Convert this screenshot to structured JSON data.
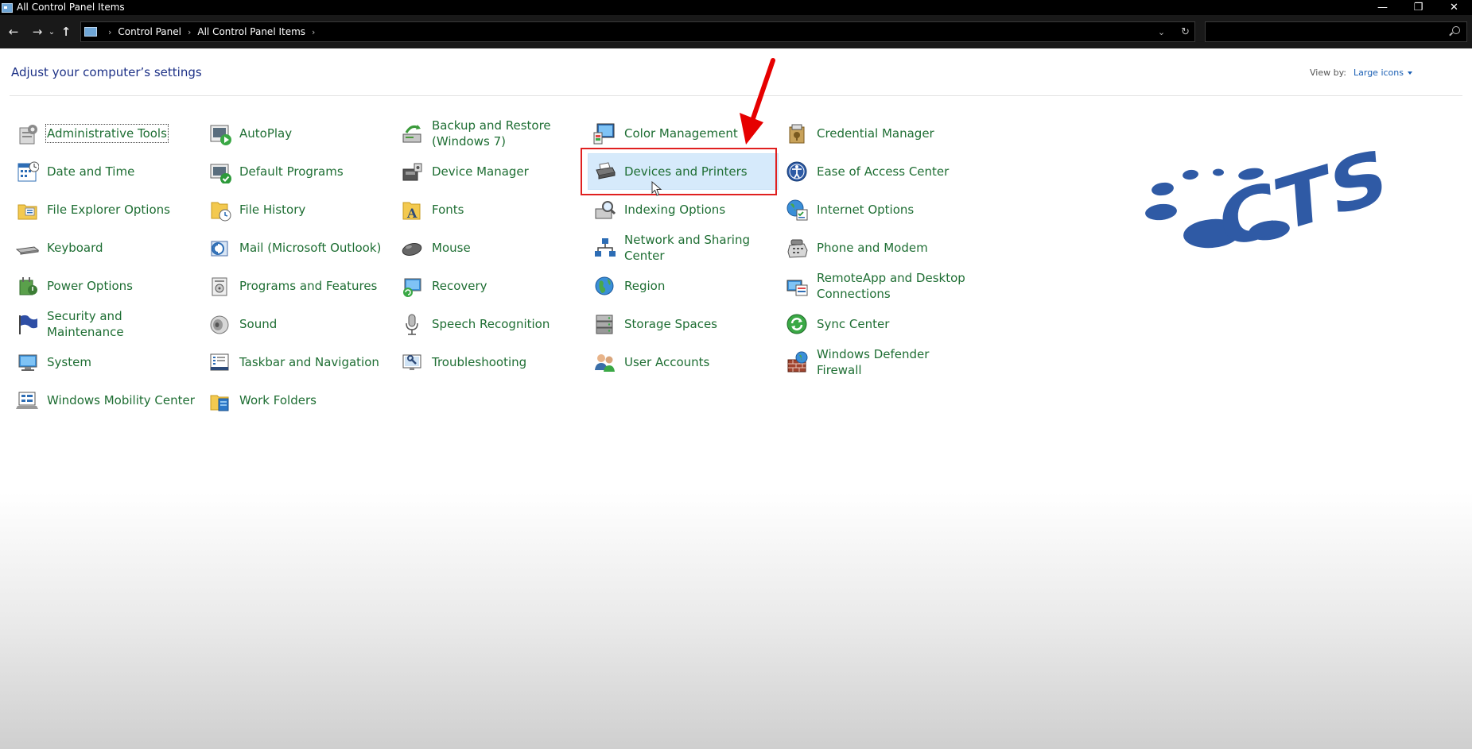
{
  "window": {
    "title": "All Control Panel Items",
    "controls": {
      "minimize": "—",
      "restore": "❐",
      "close": "✕"
    }
  },
  "nav": {
    "back": "←",
    "forward": "→",
    "recent": "⌄",
    "up": "↑",
    "breadcrumb": [
      "Control Panel",
      "All Control Panel Items"
    ],
    "separator": "›",
    "dropdown": "⌄",
    "refresh": "↻",
    "search_placeholder": ""
  },
  "header": {
    "title": "Adjust your computer’s settings",
    "view_by_label": "View by:",
    "view_by_value": "Large icons"
  },
  "colors": {
    "link_green": "#1e6e33",
    "title_blue": "#1e3287",
    "selection": "#d6eafb",
    "annotation_red": "#e02020",
    "logo_blue": "#2f5aa5"
  },
  "columns": [
    [
      {
        "label": "Administrative Tools",
        "icon": "admin-tools-icon"
      },
      {
        "label": "Date and Time",
        "icon": "calendar-icon"
      },
      {
        "label": "File Explorer Options",
        "icon": "folder-options-icon"
      },
      {
        "label": "Keyboard",
        "icon": "keyboard-icon"
      },
      {
        "label": "Power Options",
        "icon": "power-icon"
      },
      {
        "label": "Security and Maintenance",
        "icon": "flag-icon"
      },
      {
        "label": "System",
        "icon": "computer-icon"
      },
      {
        "label": "Windows Mobility Center",
        "icon": "mobility-icon"
      }
    ],
    [
      {
        "label": "AutoPlay",
        "icon": "autoplay-icon"
      },
      {
        "label": "Default Programs",
        "icon": "default-programs-icon"
      },
      {
        "label": "File History",
        "icon": "file-history-icon"
      },
      {
        "label": "Mail (Microsoft Outlook)",
        "icon": "mail-icon"
      },
      {
        "label": "Programs and Features",
        "icon": "programs-icon"
      },
      {
        "label": "Sound",
        "icon": "speaker-icon"
      },
      {
        "label": "Taskbar and Navigation",
        "icon": "taskbar-icon"
      },
      {
        "label": "Work Folders",
        "icon": "work-folders-icon"
      }
    ],
    [
      {
        "label": "Backup and Restore (Windows 7)",
        "icon": "backup-icon"
      },
      {
        "label": "Device Manager",
        "icon": "device-manager-icon"
      },
      {
        "label": "Fonts",
        "icon": "fonts-icon"
      },
      {
        "label": "Mouse",
        "icon": "mouse-icon"
      },
      {
        "label": "Recovery",
        "icon": "recovery-icon"
      },
      {
        "label": "Speech Recognition",
        "icon": "microphone-icon"
      },
      {
        "label": "Troubleshooting",
        "icon": "troubleshoot-icon"
      }
    ],
    [
      {
        "label": "Color Management",
        "icon": "color-management-icon"
      },
      {
        "label": "Devices and Printers",
        "icon": "printer-icon"
      },
      {
        "label": "Indexing Options",
        "icon": "indexing-icon"
      },
      {
        "label": "Network and Sharing Center",
        "icon": "network-icon"
      },
      {
        "label": "Region",
        "icon": "globe-icon"
      },
      {
        "label": "Storage Spaces",
        "icon": "storage-icon"
      },
      {
        "label": "User Accounts",
        "icon": "users-icon"
      }
    ],
    [
      {
        "label": "Credential Manager",
        "icon": "credential-icon"
      },
      {
        "label": "Ease of Access Center",
        "icon": "ease-of-access-icon"
      },
      {
        "label": "Internet Options",
        "icon": "internet-options-icon"
      },
      {
        "label": "Phone and Modem",
        "icon": "phone-icon"
      },
      {
        "label": "RemoteApp and Desktop Connections",
        "icon": "remoteapp-icon"
      },
      {
        "label": "Sync Center",
        "icon": "sync-icon"
      },
      {
        "label": "Windows Defender Firewall",
        "icon": "firewall-icon"
      }
    ]
  ],
  "logo_text": "CTS"
}
